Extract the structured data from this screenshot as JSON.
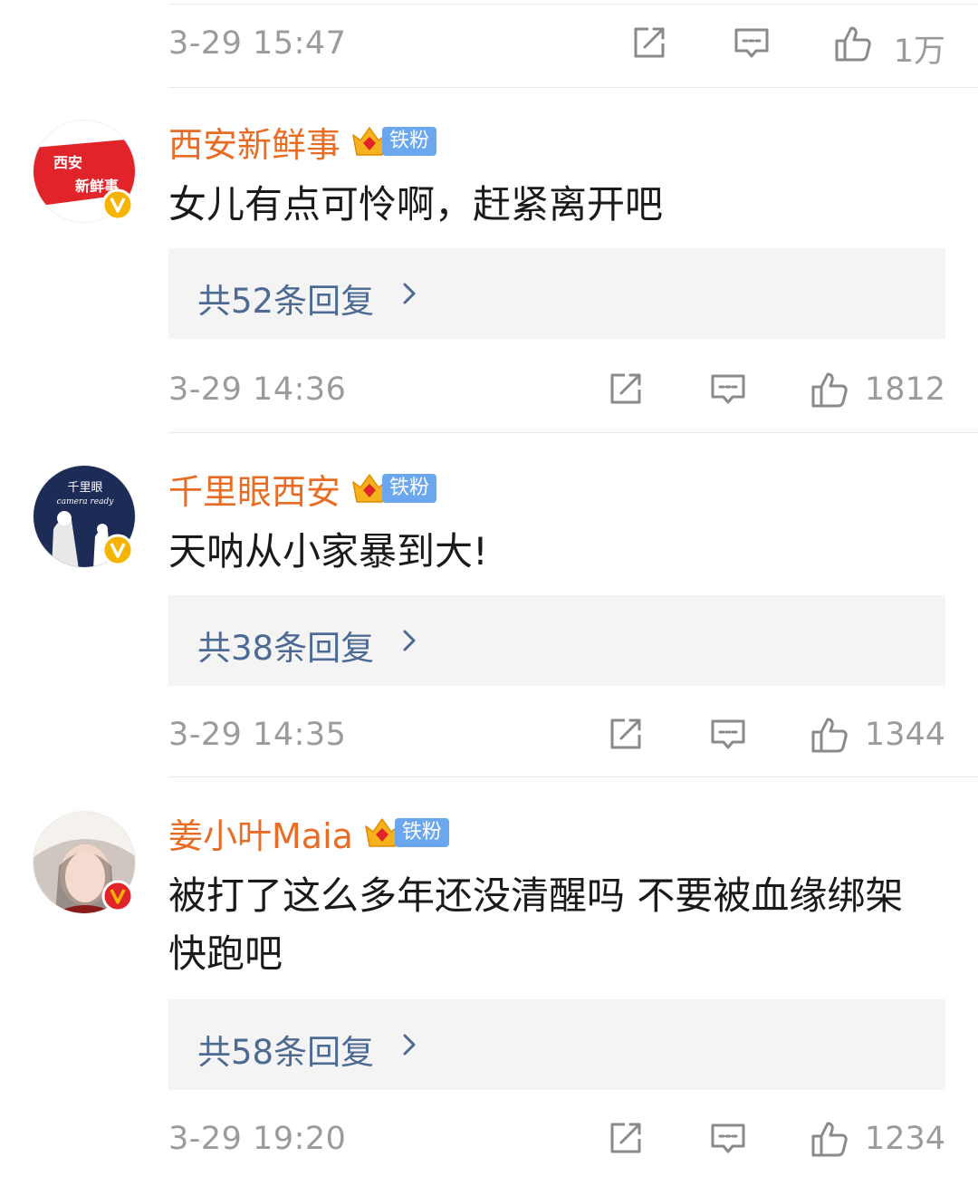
{
  "top_meta": {
    "time": "3-29 15:47",
    "like_count": "1万",
    "share_icon": "share-icon",
    "comment_icon": "comment-icon",
    "like_icon": "thumbs-up-icon"
  },
  "comments": [
    {
      "username": "西安新鲜事",
      "fan_badge": "铁粉",
      "text": "女儿有点可怜啊，赶紧离开吧",
      "reply_link": "共52条回复",
      "time": "3-29 14:36",
      "like_count": "1812",
      "avatar_lines": [
        "西安",
        "新鲜事"
      ],
      "verified_color": "#f5b400"
    },
    {
      "username": "千里眼西安",
      "fan_badge": "铁粉",
      "text": "天呐从小家暴到大!",
      "reply_link": "共38条回复",
      "time": "3-29 14:35",
      "like_count": "1344",
      "avatar_lines": [
        "千里眼",
        "camera ready"
      ],
      "verified_color": "#f5b400"
    },
    {
      "username": "姜小叶Maia",
      "fan_badge": "铁粉",
      "text": "被打了这么多年还没清醒吗 不要被血缘绑架 快跑吧",
      "reply_link": "共58条回复",
      "time": "3-29 19:20",
      "like_count": "1234",
      "verified_color": "#f5b400"
    }
  ],
  "colors": {
    "username": "#e86c23",
    "reply_link": "#4d6a93",
    "meta_gray": "#9b9b9b",
    "fan_tag": "#6aa7ee",
    "reply_bg": "#f4f4f4"
  }
}
